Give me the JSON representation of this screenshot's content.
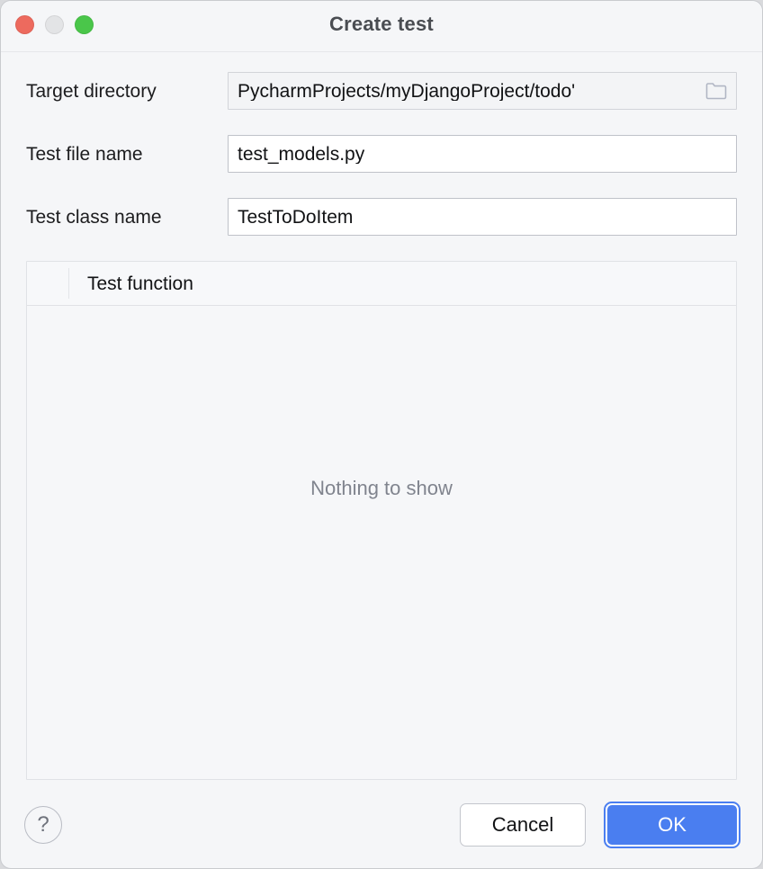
{
  "window": {
    "title": "Create test",
    "controls": {
      "close": "close-button",
      "minimize": "minimize-button",
      "zoom": "zoom-button"
    },
    "colors": {
      "close": "#ED6A5E",
      "minimize": "#E3E4E6",
      "zoom": "#4AC64A",
      "background": "#F5F6F8",
      "accent": "#4A7EF0",
      "muted_text": "#80848E"
    }
  },
  "form": {
    "target_directory": {
      "label": "Target directory",
      "value": "'PycharmProjects/myDjangoProject/todo",
      "placeholder": "",
      "browse_icon": "folder-icon",
      "readonly": true
    },
    "test_file_name": {
      "label": "Test file name",
      "value": "test_models.py",
      "placeholder": ""
    },
    "test_class_name": {
      "label": "Test class name",
      "value": "TestToDoItem",
      "placeholder": ""
    }
  },
  "table": {
    "columns": [
      "",
      "Test function"
    ],
    "rows": [],
    "empty_message": "Nothing to show"
  },
  "footer": {
    "help_label": "?",
    "cancel_label": "Cancel",
    "ok_label": "OK"
  }
}
